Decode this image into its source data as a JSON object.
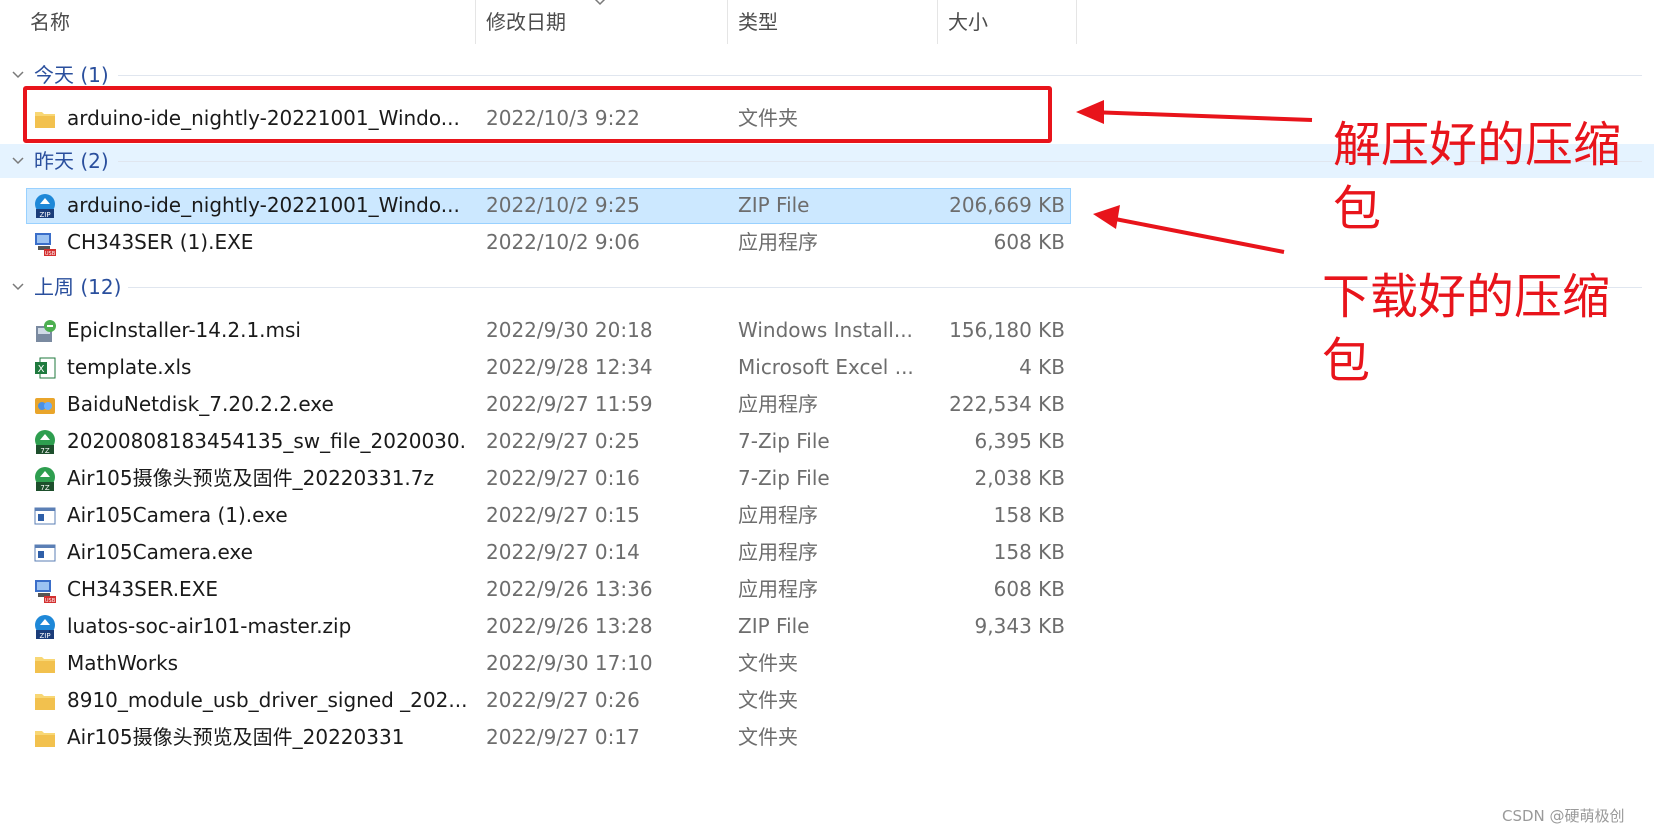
{
  "header": {
    "name": "名称",
    "date": "修改日期",
    "type": "类型",
    "size": "大小"
  },
  "groups": [
    {
      "label": "今天 (1)",
      "rows": [
        {
          "icon": "folder-icon",
          "name": "arduino-ide_nightly-20221001_Windo...",
          "date": "2022/10/3 9:22",
          "type": "文件夹",
          "size": ""
        }
      ]
    },
    {
      "label": "昨天 (2)",
      "rows": [
        {
          "icon": "zip-file-icon",
          "name": "arduino-ide_nightly-20221001_Windo...",
          "date": "2022/10/2 9:25",
          "type": "ZIP File",
          "size": "206,669 KB"
        },
        {
          "icon": "usb-installer-icon",
          "name": "CH343SER (1).EXE",
          "date": "2022/10/2 9:06",
          "type": "应用程序",
          "size": "608 KB"
        }
      ]
    },
    {
      "label": "上周 (12)",
      "rows": [
        {
          "icon": "msi-installer-icon",
          "name": "EpicInstaller-14.2.1.msi",
          "date": "2022/9/30 20:18",
          "type": "Windows Install...",
          "size": "156,180 KB"
        },
        {
          "icon": "excel-icon",
          "name": "template.xls",
          "date": "2022/9/28 12:34",
          "type": "Microsoft Excel ...",
          "size": "4 KB"
        },
        {
          "icon": "baidu-netdisk-icon",
          "name": "BaiduNetdisk_7.20.2.2.exe",
          "date": "2022/9/27 11:59",
          "type": "应用程序",
          "size": "222,534 KB"
        },
        {
          "icon": "7zip-file-icon",
          "name": "20200808183454135_sw_file_2020030...",
          "date": "2022/9/27 0:25",
          "type": "7-Zip File",
          "size": "6,395 KB"
        },
        {
          "icon": "7zip-file-icon",
          "name": "Air105摄像头预览及固件_20220331.7z",
          "date": "2022/9/27 0:16",
          "type": "7-Zip File",
          "size": "2,038 KB"
        },
        {
          "icon": "app-window-icon",
          "name": "Air105Camera (1).exe",
          "date": "2022/9/27 0:15",
          "type": "应用程序",
          "size": "158 KB"
        },
        {
          "icon": "app-window-icon",
          "name": "Air105Camera.exe",
          "date": "2022/9/27 0:14",
          "type": "应用程序",
          "size": "158 KB"
        },
        {
          "icon": "usb-installer-icon",
          "name": "CH343SER.EXE",
          "date": "2022/9/26 13:36",
          "type": "应用程序",
          "size": "608 KB"
        },
        {
          "icon": "zip-file-icon",
          "name": "luatos-soc-air101-master.zip",
          "date": "2022/9/26 13:28",
          "type": "ZIP File",
          "size": "9,343 KB"
        },
        {
          "icon": "folder-icon",
          "name": "MathWorks",
          "date": "2022/9/30 17:10",
          "type": "文件夹",
          "size": ""
        },
        {
          "icon": "folder-icon",
          "name": "8910_module_usb_driver_signed _202...",
          "date": "2022/9/27 0:26",
          "type": "文件夹",
          "size": ""
        },
        {
          "icon": "folder-icon",
          "name": "Air105摄像头预览及固件_20220331",
          "date": "2022/9/27 0:17",
          "type": "文件夹",
          "size": ""
        }
      ]
    }
  ],
  "annotations": {
    "extracted_line1": "解压好的压缩",
    "extracted_line2": "包",
    "downloaded_line1": "下载好的压缩",
    "downloaded_line2": "包"
  },
  "watermark": "CSDN @硬萌极创",
  "colors": {
    "accent_red": "#e8141b",
    "group_blue": "#2a4f9d",
    "selection": "#cce8ff"
  }
}
